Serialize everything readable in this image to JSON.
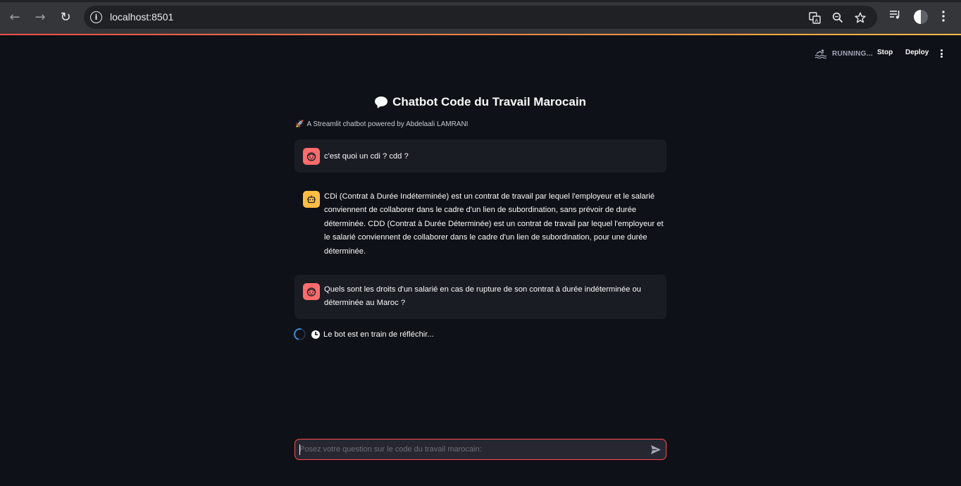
{
  "browser": {
    "url": "localhost:8501"
  },
  "header": {
    "status": "RUNNING...",
    "stop_label": "Stop",
    "deploy_label": "Deploy"
  },
  "main": {
    "title": "Chatbot Code du Travail Marocain",
    "subtitle": "A Streamlit chatbot powered by Abdelaali LAMRANI"
  },
  "messages": [
    {
      "role": "user",
      "text": "c'est quoi un cdi ? cdd ?"
    },
    {
      "role": "assistant",
      "text": "CDi (Contrat à Durée Indéterminée) est un contrat de travail par lequel l'employeur et le salarié conviennent de collaborer dans le cadre d'un lien de subordination, sans prévoir de durée déterminée. CDD (Contrat à Durée Déterminée) est un contrat de travail par lequel l'employeur et le salarié conviennent de collaborer dans le cadre d'un lien de subordination, pour une durée déterminée."
    },
    {
      "role": "user",
      "text": "Quels sont les droits d'un salarié en cas de rupture de son contrat à durée indéterminée ou déterminée au Maroc ?"
    }
  ],
  "status": {
    "thinking": "Le bot est en train de réfléchir..."
  },
  "input": {
    "placeholder": "Posez votre question sur le code du travail marocain:"
  },
  "colors": {
    "background": "#0e1117",
    "user_bubble": "#1a1c24",
    "user_avatar": "#ff6c6c",
    "bot_avatar": "#ffbd45",
    "accent": "#ff4b4b",
    "spinner": "#3c8fdc"
  }
}
